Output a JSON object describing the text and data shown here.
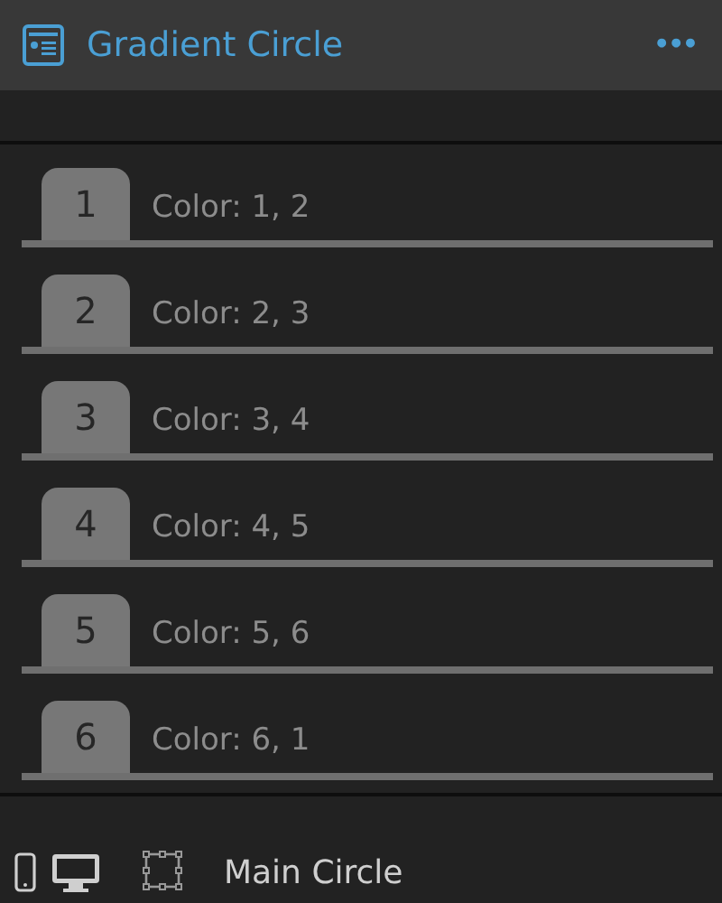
{
  "header": {
    "title": "Gradient Circle",
    "menu": "•••"
  },
  "items": [
    {
      "number": "1",
      "label": "Color: 1, 2"
    },
    {
      "number": "2",
      "label": "Color: 2, 3"
    },
    {
      "number": "3",
      "label": "Color: 3, 4"
    },
    {
      "number": "4",
      "label": "Color: 4, 5"
    },
    {
      "number": "5",
      "label": "Color: 5, 6"
    },
    {
      "number": "6",
      "label": "Color: 6, 1"
    }
  ],
  "footer": {
    "element": "Main Circle"
  }
}
